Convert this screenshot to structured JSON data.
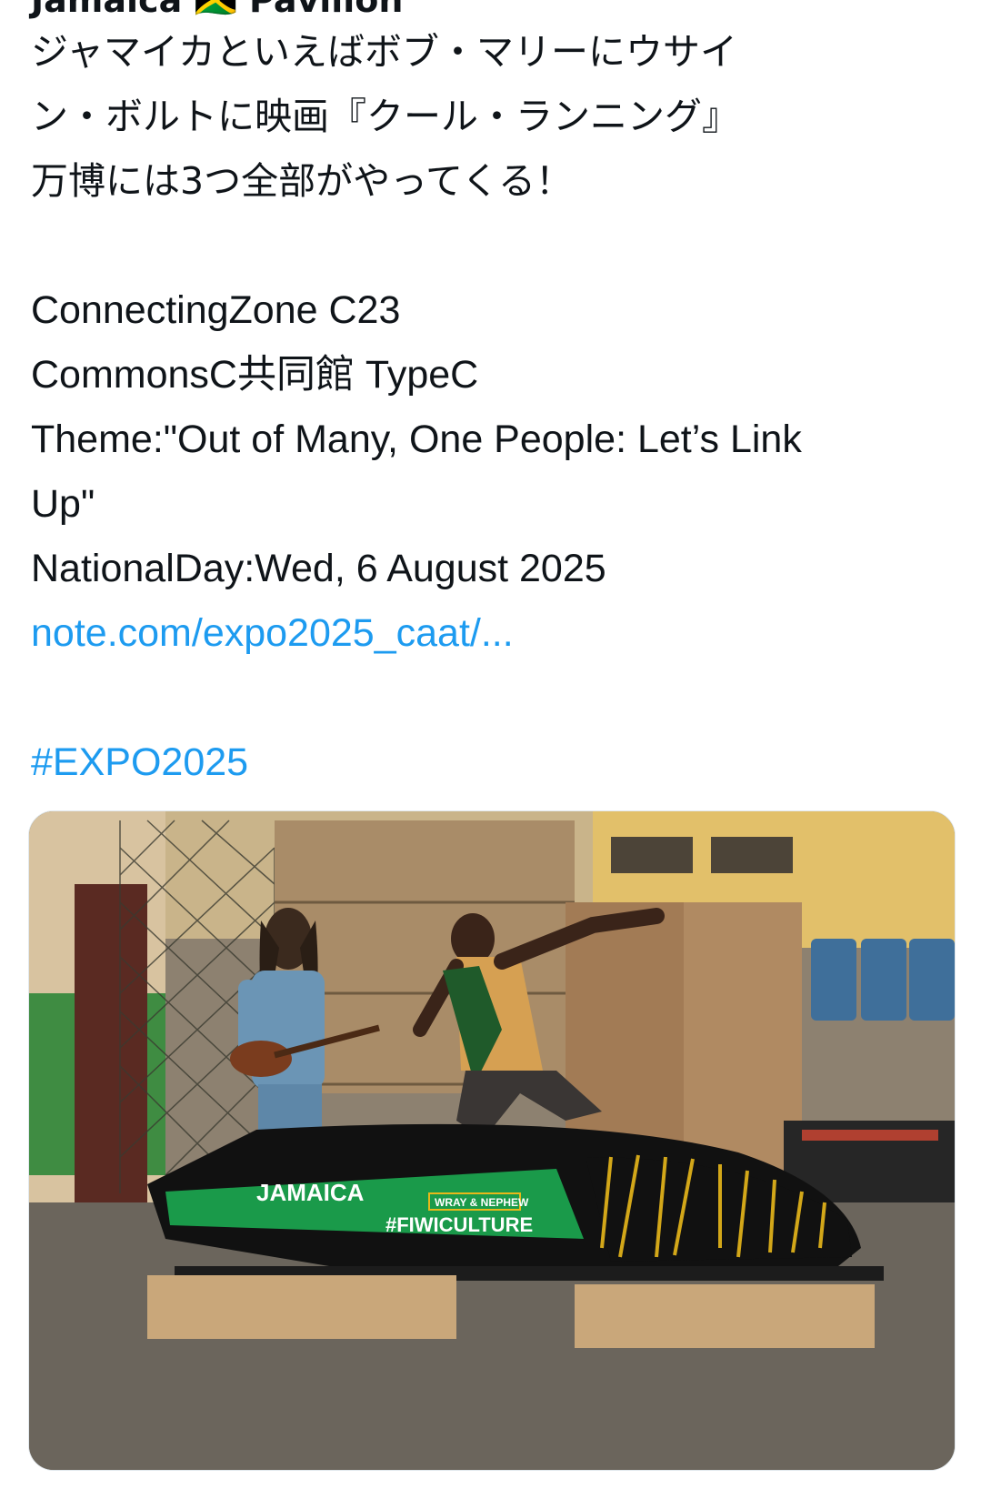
{
  "header": {
    "author_partial": "Jamaica 🇯🇲 Pavilion"
  },
  "tweet": {
    "lines_ja": [
      "ジャマイカといえばボブ・マリーにウサイ",
      "ン・ボルトに映画『クール・ランニング』",
      "万博には3つ全部がやってくる！"
    ],
    "lines_en": [
      "ConnectingZone C23",
      "CommonsC共同館 TypeC",
      "Theme:\"Out of Many, One People: Let’s Link",
      "Up\"",
      "NationalDay:Wed, 6 August 2025"
    ],
    "link": "note.com/expo2025_caat/...",
    "hashtag": "#EXPO2025"
  },
  "media": {
    "sled_text": "JAMAICA",
    "sponsor_small": "WRAY & NEPHEW",
    "sponsor_big": "#FIWICULTURE",
    "colors": {
      "sled_green": "#1a9a4a",
      "sled_black": "#111111",
      "sled_gold": "#e8b81a"
    }
  },
  "colors": {
    "text": "#0f1419",
    "link": "#1d9bf0"
  }
}
